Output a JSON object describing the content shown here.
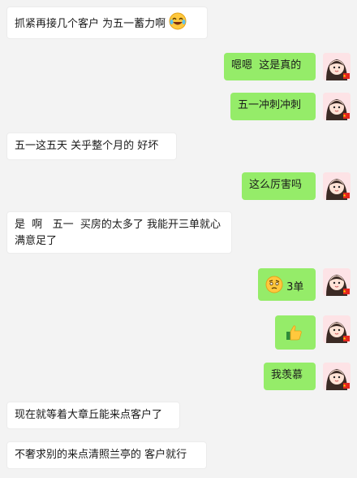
{
  "messages": [
    {
      "side": "in",
      "text": "抓紧再接几个客户 为五一蓄力啊",
      "emoji": "laughing-crying-emoji"
    },
    {
      "side": "out",
      "text": "嗯嗯  这是真的"
    },
    {
      "side": "out",
      "text": "五一冲刺冲刺"
    },
    {
      "side": "in",
      "text": "五一这五天 关乎整个月的 好坏"
    },
    {
      "side": "out",
      "text": "这么厉害吗"
    },
    {
      "side": "in",
      "text": "是  啊   五一  买房的太多了 我能开三单就心满意足了"
    },
    {
      "side": "out",
      "text": "3单",
      "emoji": "thinking-emoji"
    },
    {
      "side": "out",
      "text": "",
      "emoji": "thumbs-up-emoji"
    },
    {
      "side": "out",
      "text": "我羡慕"
    },
    {
      "side": "in",
      "text": "现在就等着大章丘能来点客户了"
    },
    {
      "side": "in",
      "text": "不奢求别的来点清照兰亭的 客户就行"
    }
  ],
  "colors": {
    "background": "#f3f3f3",
    "incoming_bubble": "#ffffff",
    "outgoing_bubble": "#95ec69"
  }
}
